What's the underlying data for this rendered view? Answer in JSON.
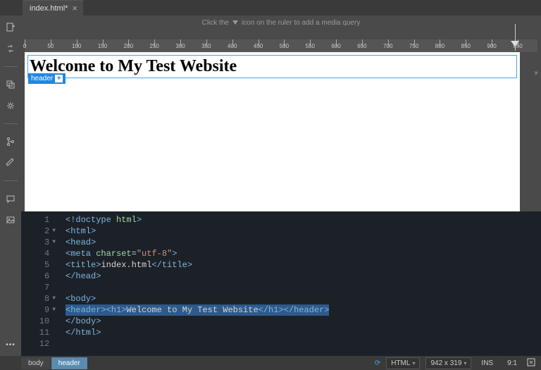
{
  "tab": {
    "name": "index.html*"
  },
  "hint": {
    "prefix": "Click the",
    "suffix": "icon on the ruler to add a media query"
  },
  "ruler": {
    "ticks": [
      0,
      50,
      100,
      150,
      200,
      250,
      300,
      350,
      400,
      450,
      500,
      550,
      600,
      650,
      700,
      750,
      800,
      850,
      900,
      950
    ]
  },
  "preview": {
    "heading": "Welcome to My Test Website",
    "tag_label": "header"
  },
  "code": {
    "lines": [
      {
        "n": 1,
        "fold": "",
        "html": "<span class='tk-tag'>&lt;!doctype <span class='tk-attr'>html</span>&gt;</span>"
      },
      {
        "n": 2,
        "fold": "▼",
        "html": "<span class='tk-tag'>&lt;html&gt;</span>"
      },
      {
        "n": 3,
        "fold": "▼",
        "html": "<span class='tk-tag'>&lt;head&gt;</span>"
      },
      {
        "n": 4,
        "fold": "",
        "html": "<span class='tk-tag'>&lt;meta</span> <span class='tk-attr'>charset</span>=<span class='tk-str'>\"utf-8\"</span><span class='tk-tag'>&gt;</span>"
      },
      {
        "n": 5,
        "fold": "",
        "html": "<span class='tk-tag'>&lt;title&gt;</span><span class='tk-txt'>index.html</span><span class='tk-tag'>&lt;/title&gt;</span>"
      },
      {
        "n": 6,
        "fold": "",
        "html": "<span class='tk-tag'>&lt;/head&gt;</span>"
      },
      {
        "n": 7,
        "fold": "",
        "html": ""
      },
      {
        "n": 8,
        "fold": "▼",
        "html": "<span class='tk-tag'>&lt;body&gt;</span>"
      },
      {
        "n": 9,
        "fold": "▼",
        "html": "<span class='hl'><span class='tk-tag'>&lt;header&gt;&lt;h1&gt;</span><span class='tk-txt'>Welcome to My Test Website</span><span class='tk-tag'>&lt;/h1&gt;&lt;/header&gt;</span></span>"
      },
      {
        "n": 10,
        "fold": "",
        "html": "<span class='tk-tag'>&lt;/body&gt;</span>"
      },
      {
        "n": 11,
        "fold": "",
        "html": "<span class='tk-tag'>&lt;/html&gt;</span>"
      },
      {
        "n": 12,
        "fold": "",
        "html": ""
      }
    ]
  },
  "breadcrumb": [
    "body",
    "header"
  ],
  "status": {
    "lang": "HTML",
    "dims": "942 x 319",
    "ins": "INS",
    "pos": "9:1"
  }
}
